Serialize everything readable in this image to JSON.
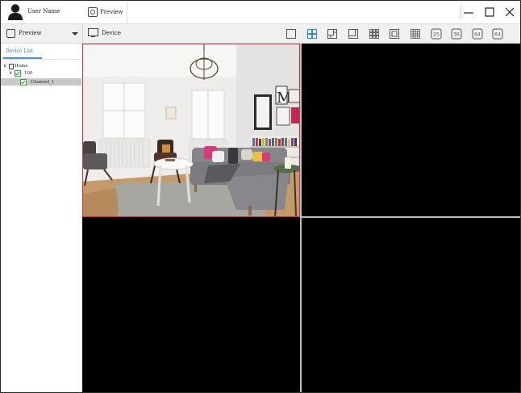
{
  "titlebar": {
    "user_name": "User Name",
    "tab_label": "Preview",
    "icons": {
      "user": "user-icon",
      "tab": "preview-icon",
      "minimize": "minimize-icon",
      "maximize": "maximize-icon",
      "close": "close-icon"
    }
  },
  "toolbar": {
    "preview_dropdown": "Preview",
    "device_label": "Device",
    "layouts": [
      "1",
      "4",
      "6",
      "8",
      "9",
      "10",
      "16",
      "25",
      "36",
      "64",
      "64"
    ],
    "selected_layout_index": 1,
    "accent_color": "#4a90e2"
  },
  "sidebar": {
    "tab_label": "Device List",
    "tree": [
      {
        "label": "Home",
        "level": 0
      },
      {
        "label": "100",
        "level": 1
      },
      {
        "label": "Channel_1",
        "level": 2,
        "selected": true
      }
    ]
  },
  "video": {
    "active_cell": 1,
    "active_border_color": "#d0303a",
    "cells": 4
  }
}
